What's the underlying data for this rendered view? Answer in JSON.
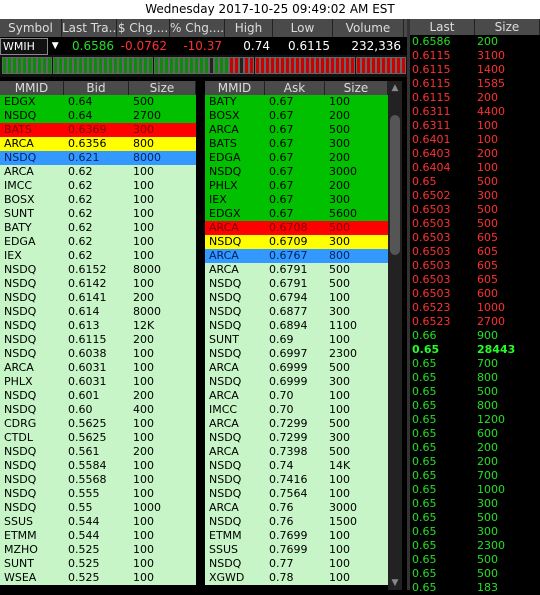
{
  "window_title": "Wednesday 2017-10-25 09:49:02 AM EST",
  "quote_header": [
    "Symbol",
    "Last Tra...",
    "$ Chg....",
    "% Chg....",
    "High",
    "Low",
    "Volume"
  ],
  "quote": {
    "symbol": "WMIH",
    "last": "0.6586",
    "chg": "-0.0762",
    "pct": "-10.37",
    "high": "0.74",
    "low": "0.6115",
    "volume": "232,336"
  },
  "colors": {
    "green": "#00c000",
    "red": "#ff0000",
    "yellow": "#ffff00",
    "blue": "#3399ff",
    "light_green": "#c7f5c7",
    "pos_text": "#22e022",
    "neg_text": "#ff3030"
  },
  "ticker_pattern": [
    "g",
    "g",
    "g",
    "g",
    "g",
    "g",
    "g",
    "g",
    "g",
    "g",
    "g",
    "g",
    "g",
    "g",
    "g",
    "g",
    "g",
    "g",
    "g",
    "g",
    "g",
    "g",
    "g",
    "g",
    "g",
    "g",
    "g",
    "g",
    "g",
    "g",
    "g",
    "g",
    "g",
    "g",
    "g",
    "g",
    "g",
    "g",
    "g",
    "g",
    "g",
    "b",
    "g",
    "g",
    "g",
    "r",
    "r",
    "b",
    "r",
    "r",
    "r",
    "r",
    "r",
    "r",
    "r",
    "r",
    "r",
    "r",
    "r",
    "r",
    "r",
    "r",
    "r",
    "r",
    "r",
    "r",
    "r",
    "r",
    "r",
    "r",
    "r",
    "r",
    "r",
    "r",
    "r",
    "r",
    "r",
    "r",
    "r",
    "r"
  ],
  "bid_header": [
    "MMID",
    "Bid",
    "Size"
  ],
  "bids": [
    {
      "mmid": "EDGX",
      "price": "0.64",
      "size": "500",
      "color": "green"
    },
    {
      "mmid": "NSDQ",
      "price": "0.64",
      "size": "2700",
      "color": "green"
    },
    {
      "mmid": "BATS",
      "price": "0.6369",
      "size": "300",
      "color": "red"
    },
    {
      "mmid": "ARCA",
      "price": "0.6356",
      "size": "800",
      "color": "yellow"
    },
    {
      "mmid": "NSDQ",
      "price": "0.621",
      "size": "8000",
      "color": "blue"
    },
    {
      "mmid": "ARCA",
      "price": "0.62",
      "size": "100",
      "color": "light"
    },
    {
      "mmid": "IMCC",
      "price": "0.62",
      "size": "100",
      "color": "light"
    },
    {
      "mmid": "BOSX",
      "price": "0.62",
      "size": "100",
      "color": "light"
    },
    {
      "mmid": "SUNT",
      "price": "0.62",
      "size": "100",
      "color": "light"
    },
    {
      "mmid": "BATY",
      "price": "0.62",
      "size": "100",
      "color": "light"
    },
    {
      "mmid": "EDGA",
      "price": "0.62",
      "size": "100",
      "color": "light"
    },
    {
      "mmid": "IEX",
      "price": "0.62",
      "size": "100",
      "color": "light"
    },
    {
      "mmid": "NSDQ",
      "price": "0.6152",
      "size": "8000",
      "color": "light"
    },
    {
      "mmid": "NSDQ",
      "price": "0.6142",
      "size": "100",
      "color": "light"
    },
    {
      "mmid": "NSDQ",
      "price": "0.6141",
      "size": "200",
      "color": "light"
    },
    {
      "mmid": "NSDQ",
      "price": "0.614",
      "size": "8000",
      "color": "light"
    },
    {
      "mmid": "NSDQ",
      "price": "0.613",
      "size": "12K",
      "color": "light"
    },
    {
      "mmid": "NSDQ",
      "price": "0.6115",
      "size": "200",
      "color": "light"
    },
    {
      "mmid": "NSDQ",
      "price": "0.6038",
      "size": "100",
      "color": "light"
    },
    {
      "mmid": "ARCA",
      "price": "0.6031",
      "size": "100",
      "color": "light"
    },
    {
      "mmid": "PHLX",
      "price": "0.6031",
      "size": "100",
      "color": "light"
    },
    {
      "mmid": "NSDQ",
      "price": "0.601",
      "size": "200",
      "color": "light"
    },
    {
      "mmid": "NSDQ",
      "price": "0.60",
      "size": "400",
      "color": "light"
    },
    {
      "mmid": "CDRG",
      "price": "0.5625",
      "size": "100",
      "color": "light"
    },
    {
      "mmid": "CTDL",
      "price": "0.5625",
      "size": "100",
      "color": "light"
    },
    {
      "mmid": "NSDQ",
      "price": "0.561",
      "size": "200",
      "color": "light"
    },
    {
      "mmid": "NSDQ",
      "price": "0.5584",
      "size": "100",
      "color": "light"
    },
    {
      "mmid": "NSDQ",
      "price": "0.5568",
      "size": "100",
      "color": "light"
    },
    {
      "mmid": "NSDQ",
      "price": "0.555",
      "size": "100",
      "color": "light"
    },
    {
      "mmid": "NSDQ",
      "price": "0.55",
      "size": "1000",
      "color": "light"
    },
    {
      "mmid": "SSUS",
      "price": "0.544",
      "size": "100",
      "color": "light"
    },
    {
      "mmid": "ETMM",
      "price": "0.544",
      "size": "100",
      "color": "light"
    },
    {
      "mmid": "MZHO",
      "price": "0.525",
      "size": "100",
      "color": "light"
    },
    {
      "mmid": "SUNT",
      "price": "0.525",
      "size": "100",
      "color": "light"
    },
    {
      "mmid": "WSEA",
      "price": "0.525",
      "size": "100",
      "color": "light"
    }
  ],
  "ask_header": [
    "MMID",
    "Ask",
    "Size"
  ],
  "asks": [
    {
      "mmid": "BATY",
      "price": "0.67",
      "size": "100",
      "color": "green"
    },
    {
      "mmid": "BOSX",
      "price": "0.67",
      "size": "200",
      "color": "green"
    },
    {
      "mmid": "ARCA",
      "price": "0.67",
      "size": "500",
      "color": "green"
    },
    {
      "mmid": "BATS",
      "price": "0.67",
      "size": "300",
      "color": "green"
    },
    {
      "mmid": "EDGA",
      "price": "0.67",
      "size": "200",
      "color": "green"
    },
    {
      "mmid": "NSDQ",
      "price": "0.67",
      "size": "3000",
      "color": "green"
    },
    {
      "mmid": "PHLX",
      "price": "0.67",
      "size": "200",
      "color": "green"
    },
    {
      "mmid": "IEX",
      "price": "0.67",
      "size": "300",
      "color": "green"
    },
    {
      "mmid": "EDGX",
      "price": "0.67",
      "size": "5600",
      "color": "green"
    },
    {
      "mmid": "ARCA",
      "price": "0.6708",
      "size": "500",
      "color": "red"
    },
    {
      "mmid": "NSDQ",
      "price": "0.6709",
      "size": "300",
      "color": "yellow"
    },
    {
      "mmid": "ARCA",
      "price": "0.6767",
      "size": "800",
      "color": "blue"
    },
    {
      "mmid": "ARCA",
      "price": "0.6791",
      "size": "500",
      "color": "light"
    },
    {
      "mmid": "NSDQ",
      "price": "0.6791",
      "size": "500",
      "color": "light"
    },
    {
      "mmid": "NSDQ",
      "price": "0.6794",
      "size": "100",
      "color": "light"
    },
    {
      "mmid": "NSDQ",
      "price": "0.6877",
      "size": "300",
      "color": "light"
    },
    {
      "mmid": "NSDQ",
      "price": "0.6894",
      "size": "1100",
      "color": "light"
    },
    {
      "mmid": "SUNT",
      "price": "0.69",
      "size": "100",
      "color": "light"
    },
    {
      "mmid": "NSDQ",
      "price": "0.6997",
      "size": "2300",
      "color": "light"
    },
    {
      "mmid": "ARCA",
      "price": "0.6999",
      "size": "500",
      "color": "light"
    },
    {
      "mmid": "NSDQ",
      "price": "0.6999",
      "size": "300",
      "color": "light"
    },
    {
      "mmid": "ARCA",
      "price": "0.70",
      "size": "100",
      "color": "light"
    },
    {
      "mmid": "IMCC",
      "price": "0.70",
      "size": "100",
      "color": "light"
    },
    {
      "mmid": "ARCA",
      "price": "0.7299",
      "size": "500",
      "color": "light"
    },
    {
      "mmid": "NSDQ",
      "price": "0.7299",
      "size": "300",
      "color": "light"
    },
    {
      "mmid": "ARCA",
      "price": "0.7398",
      "size": "500",
      "color": "light"
    },
    {
      "mmid": "NSDQ",
      "price": "0.74",
      "size": "14K",
      "color": "light"
    },
    {
      "mmid": "NSDQ",
      "price": "0.7416",
      "size": "100",
      "color": "light"
    },
    {
      "mmid": "NSDQ",
      "price": "0.7564",
      "size": "100",
      "color": "light"
    },
    {
      "mmid": "ARCA",
      "price": "0.76",
      "size": "3000",
      "color": "light"
    },
    {
      "mmid": "NSDQ",
      "price": "0.76",
      "size": "1500",
      "color": "light"
    },
    {
      "mmid": "ETMM",
      "price": "0.7699",
      "size": "100",
      "color": "light"
    },
    {
      "mmid": "SSUS",
      "price": "0.7699",
      "size": "100",
      "color": "light"
    },
    {
      "mmid": "NSDQ",
      "price": "0.77",
      "size": "100",
      "color": "light"
    },
    {
      "mmid": "XGWD",
      "price": "0.78",
      "size": "100",
      "color": "light"
    }
  ],
  "ts_header": [
    "Last",
    "Size"
  ],
  "trades": [
    {
      "price": "0.6586",
      "size": "200",
      "tone": "green"
    },
    {
      "price": "0.6115",
      "size": "3100",
      "tone": "red"
    },
    {
      "price": "0.6115",
      "size": "1400",
      "tone": "red"
    },
    {
      "price": "0.6115",
      "size": "1585",
      "tone": "red"
    },
    {
      "price": "0.6115",
      "size": "200",
      "tone": "red"
    },
    {
      "price": "0.6311",
      "size": "4400",
      "tone": "red"
    },
    {
      "price": "0.6311",
      "size": "100",
      "tone": "red"
    },
    {
      "price": "0.6401",
      "size": "100",
      "tone": "red"
    },
    {
      "price": "0.6403",
      "size": "200",
      "tone": "red"
    },
    {
      "price": "0.6404",
      "size": "100",
      "tone": "red"
    },
    {
      "price": "0.65",
      "size": "500",
      "tone": "red"
    },
    {
      "price": "0.6502",
      "size": "300",
      "tone": "red"
    },
    {
      "price": "0.6503",
      "size": "500",
      "tone": "red"
    },
    {
      "price": "0.6503",
      "size": "500",
      "tone": "red"
    },
    {
      "price": "0.6503",
      "size": "605",
      "tone": "red"
    },
    {
      "price": "0.6503",
      "size": "605",
      "tone": "red"
    },
    {
      "price": "0.6503",
      "size": "605",
      "tone": "red"
    },
    {
      "price": "0.6503",
      "size": "605",
      "tone": "red"
    },
    {
      "price": "0.6503",
      "size": "600",
      "tone": "red"
    },
    {
      "price": "0.6523",
      "size": "1000",
      "tone": "red"
    },
    {
      "price": "0.6523",
      "size": "2700",
      "tone": "red"
    },
    {
      "price": "0.66",
      "size": "900",
      "tone": "green"
    },
    {
      "price": "0.65",
      "size": "28443",
      "tone": "bold"
    },
    {
      "price": "0.65",
      "size": "700",
      "tone": "green"
    },
    {
      "price": "0.65",
      "size": "800",
      "tone": "green"
    },
    {
      "price": "0.65",
      "size": "500",
      "tone": "green"
    },
    {
      "price": "0.65",
      "size": "800",
      "tone": "green"
    },
    {
      "price": "0.65",
      "size": "1200",
      "tone": "green"
    },
    {
      "price": "0.65",
      "size": "600",
      "tone": "green"
    },
    {
      "price": "0.65",
      "size": "200",
      "tone": "green"
    },
    {
      "price": "0.65",
      "size": "200",
      "tone": "green"
    },
    {
      "price": "0.65",
      "size": "700",
      "tone": "green"
    },
    {
      "price": "0.65",
      "size": "1000",
      "tone": "green"
    },
    {
      "price": "0.65",
      "size": "300",
      "tone": "green"
    },
    {
      "price": "0.65",
      "size": "500",
      "tone": "green"
    },
    {
      "price": "0.65",
      "size": "300",
      "tone": "green"
    },
    {
      "price": "0.65",
      "size": "2300",
      "tone": "green"
    },
    {
      "price": "0.65",
      "size": "500",
      "tone": "green"
    },
    {
      "price": "0.65",
      "size": "500",
      "tone": "green"
    },
    {
      "price": "0.65",
      "size": "183",
      "tone": "green"
    }
  ]
}
